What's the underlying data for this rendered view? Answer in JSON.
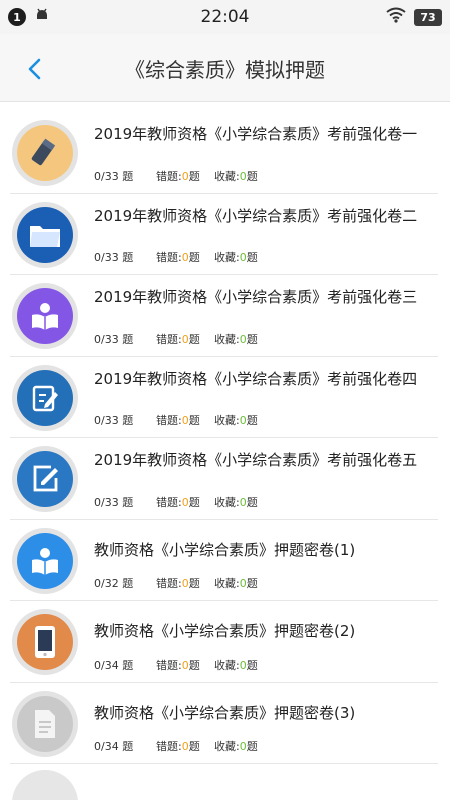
{
  "status_bar": {
    "notification_count": "1",
    "time": "22:04",
    "battery": "73",
    "icons": [
      "android-icon",
      "wifi-icon",
      "battery-icon"
    ]
  },
  "nav": {
    "title": "《综合素质》模拟押题",
    "back_icon": "chevron-left-icon",
    "accent_color": "#1a8fe0"
  },
  "items": [
    {
      "title": "2019年教师资格《小学综合素质》考前强化卷一",
      "progress": "0/33 题",
      "wrong_label": "错题:",
      "wrong_count": "0",
      "wrong_suffix": "题",
      "fav_label": "收藏:",
      "fav_count": "0",
      "fav_suffix": "题",
      "icon": "pencil-eraser-icon",
      "icon_bg": "#f5c77e"
    },
    {
      "title": "2019年教师资格《小学综合素质》考前强化卷二",
      "progress": "0/33 题",
      "wrong_label": "错题:",
      "wrong_count": "0",
      "wrong_suffix": "题",
      "fav_label": "收藏:",
      "fav_count": "0",
      "fav_suffix": "题",
      "icon": "folder-icon",
      "icon_bg": "#1a5fb4"
    },
    {
      "title": "2019年教师资格《小学综合素质》考前强化卷三",
      "progress": "0/33 题",
      "wrong_label": "错题:",
      "wrong_count": "0",
      "wrong_suffix": "题",
      "fav_label": "收藏:",
      "fav_count": "0",
      "fav_suffix": "题",
      "icon": "reader-icon",
      "icon_bg": "#8456e6"
    },
    {
      "title": "2019年教师资格《小学综合素质》考前强化卷四",
      "progress": "0/33 题",
      "wrong_label": "错题:",
      "wrong_count": "0",
      "wrong_suffix": "题",
      "fav_label": "收藏:",
      "fav_count": "0",
      "fav_suffix": "题",
      "icon": "note-edit-icon",
      "icon_bg": "#2470b8"
    },
    {
      "title": "2019年教师资格《小学综合素质》考前强化卷五",
      "progress": "0/33 题",
      "wrong_label": "错题:",
      "wrong_count": "0",
      "wrong_suffix": "题",
      "fav_label": "收藏:",
      "fav_count": "0",
      "fav_suffix": "题",
      "icon": "edit-square-icon",
      "icon_bg": "#2a78c4"
    },
    {
      "title": "教师资格《小学综合素质》押题密卷(1)",
      "progress": "0/32 题",
      "wrong_label": "错题:",
      "wrong_count": "0",
      "wrong_suffix": "题",
      "fav_label": "收藏:",
      "fav_count": "0",
      "fav_suffix": "题",
      "icon": "reader-icon",
      "icon_bg": "#2d8ee8"
    },
    {
      "title": "教师资格《小学综合素质》押题密卷(2)",
      "progress": "0/34 题",
      "wrong_label": "错题:",
      "wrong_count": "0",
      "wrong_suffix": "题",
      "fav_label": "收藏:",
      "fav_count": "0",
      "fav_suffix": "题",
      "icon": "phone-icon",
      "icon_bg": "#e28a4a"
    },
    {
      "title": "教师资格《小学综合素质》押题密卷(3)",
      "progress": "0/34 题",
      "wrong_label": "错题:",
      "wrong_count": "0",
      "wrong_suffix": "题",
      "fav_label": "收藏:",
      "fav_count": "0",
      "fav_suffix": "题",
      "icon": "document-icon",
      "icon_bg": "#c9c9c9"
    }
  ]
}
